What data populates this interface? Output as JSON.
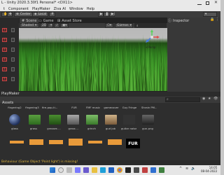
{
  "window": {
    "title": "L - Unity 2020.3.30f1 Personal* <DX11>"
  },
  "menu": [
    "t",
    "Component",
    "PlayMaker",
    "Ziva AI",
    "Window",
    "Help"
  ],
  "toolbar": {
    "center": "Center",
    "local": "Local"
  },
  "scene": {
    "tabs": [
      "Scene",
      "Game",
      "Asset Store"
    ],
    "shading": "Shaded",
    "mode": "2D",
    "gizmos": "Gizmos",
    "persp": "<Persp"
  },
  "inspector": {
    "tab": "Inspector"
  },
  "playmaker": {
    "label": "PlayMaker"
  },
  "assets": {
    "title": "Assets",
    "rows": [
      [
        "fingering2",
        "fingering3",
        "fire-pop-ti...",
        "FUR",
        "FMF music",
        "gamecover",
        "Guy Fringe",
        "Shrain PM..."
      ],
      [
        "glass",
        "grass",
        "grasses ...",
        "grass ...",
        "grinch",
        "gud job",
        "guitar noise",
        "gun-png"
      ]
    ]
  },
  "status": {
    "message": "Behaviour (Game Object 'Point light') is missing!"
  },
  "taskbar": {
    "time": "14:05",
    "date": "08-04-2022"
  },
  "colors": {
    "grass_dark": "#1f4d14",
    "grass_light": "#5ab43a",
    "error_red": "#cc4444",
    "warn_yellow": "#e0b640"
  }
}
